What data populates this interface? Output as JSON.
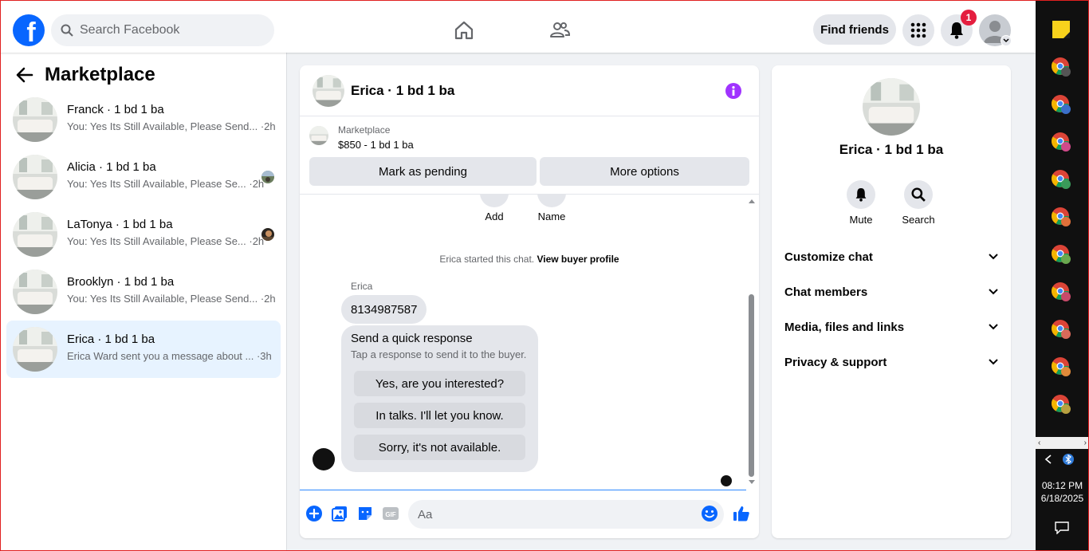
{
  "header": {
    "search_placeholder": "Search Facebook",
    "find_friends_label": "Find friends",
    "notification_count": "1"
  },
  "sidebar": {
    "title": "Marketplace",
    "conversations": [
      {
        "name": "Franck · 1 bd 1 ba",
        "preview": "You: Yes Its Still Available, Please Send... ·2h",
        "active": false
      },
      {
        "name": "Alicia · 1 bd 1 ba",
        "preview": "You: Yes Its Still Available, Please Se... ·2h",
        "active": false
      },
      {
        "name": "LaTonya · 1 bd 1 ba",
        "preview": "You: Yes Its Still Available, Please Se... ·2h",
        "active": false
      },
      {
        "name": "Brooklyn · 1 bd 1 ba",
        "preview": "You: Yes Its Still Available, Please Send... ·2h",
        "active": false
      },
      {
        "name": "Erica · 1 bd 1 ba",
        "preview": "Erica Ward sent you a message about ... ·3h",
        "active": true
      }
    ]
  },
  "chat": {
    "title": "Erica · 1 bd 1 ba",
    "listing_label": "Marketplace",
    "listing_price": "$850 - 1 bd 1 ba",
    "mark_pending_label": "Mark as pending",
    "more_options_label": "More options",
    "util_add_label": "Add",
    "util_name_label": "Name",
    "started_text": "Erica started this chat.",
    "view_profile_label": "View buyer profile",
    "sender_name": "Erica",
    "message": "8134987587",
    "quick_title": "Send a quick response",
    "quick_subtitle": "Tap a response to send it to the buyer.",
    "quick_responses": [
      "Yes, are you interested?",
      "In talks. I'll let you know.",
      "Sorry, it's not available."
    ],
    "composer_placeholder": "Aa"
  },
  "details": {
    "name": "Erica · 1 bd 1 ba",
    "mute_label": "Mute",
    "search_label": "Search",
    "sections": [
      "Customize chat",
      "Chat members",
      "Media, files and links",
      "Privacy & support"
    ]
  },
  "taskbar": {
    "time": "08:12 PM",
    "date": "6/18/2025"
  },
  "colors": {
    "accent": "#0866ff",
    "info": "#a033ff",
    "badge": "#e41e3f",
    "active_row": "#e7f3ff"
  }
}
